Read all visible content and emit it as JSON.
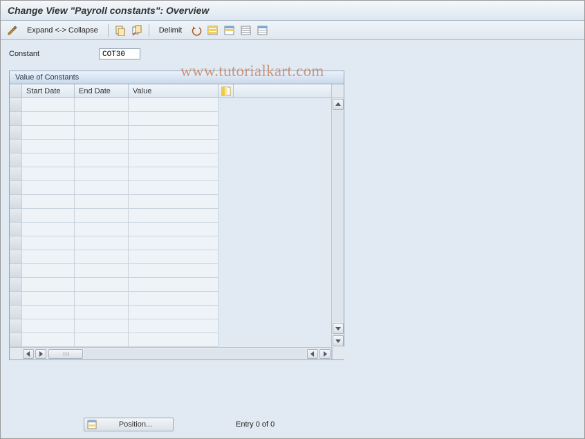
{
  "title": "Change View \"Payroll constants\": Overview",
  "toolbar": {
    "expand_collapse_label": "Expand <-> Collapse",
    "delimit_label": "Delimit"
  },
  "field": {
    "label": "Constant",
    "value": "COT30"
  },
  "panel": {
    "title": "Value of Constants",
    "columns": {
      "start_date": "Start Date",
      "end_date": "End Date",
      "value": "Value"
    },
    "row_count": 18
  },
  "footer": {
    "position_label": "Position...",
    "entry_text": "Entry 0 of 0"
  },
  "watermark": "www.tutorialkart.com"
}
